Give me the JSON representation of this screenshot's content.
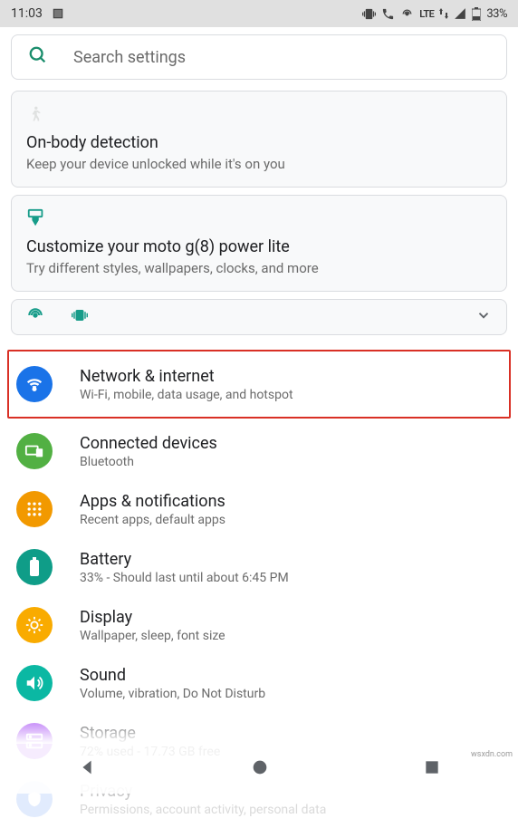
{
  "status": {
    "time": "11:03",
    "battery": "33%",
    "lte": "LTE"
  },
  "search": {
    "placeholder": "Search settings"
  },
  "card1": {
    "title": "On-body detection",
    "sub": "Keep your device unlocked while it's on you"
  },
  "card2": {
    "title": "Customize your moto g(8) power lite",
    "sub": "Try different styles, wallpapers, clocks, and more"
  },
  "items": {
    "network": {
      "title": "Network & internet",
      "sub": "Wi-Fi, mobile, data usage, and hotspot"
    },
    "devices": {
      "title": "Connected devices",
      "sub": "Bluetooth"
    },
    "apps": {
      "title": "Apps & notifications",
      "sub": "Recent apps, default apps"
    },
    "battery": {
      "title": "Battery",
      "sub": "33% - Should last until about 6:45 PM"
    },
    "display": {
      "title": "Display",
      "sub": "Wallpaper, sleep, font size"
    },
    "sound": {
      "title": "Sound",
      "sub": "Volume, vibration, Do Not Disturb"
    },
    "storage": {
      "title": "Storage",
      "sub": "72% used - 17.73 GB free"
    },
    "privacy": {
      "title": "Privacy",
      "sub": "Permissions, account activity, personal data"
    }
  },
  "watermark": "wsxdn.com"
}
